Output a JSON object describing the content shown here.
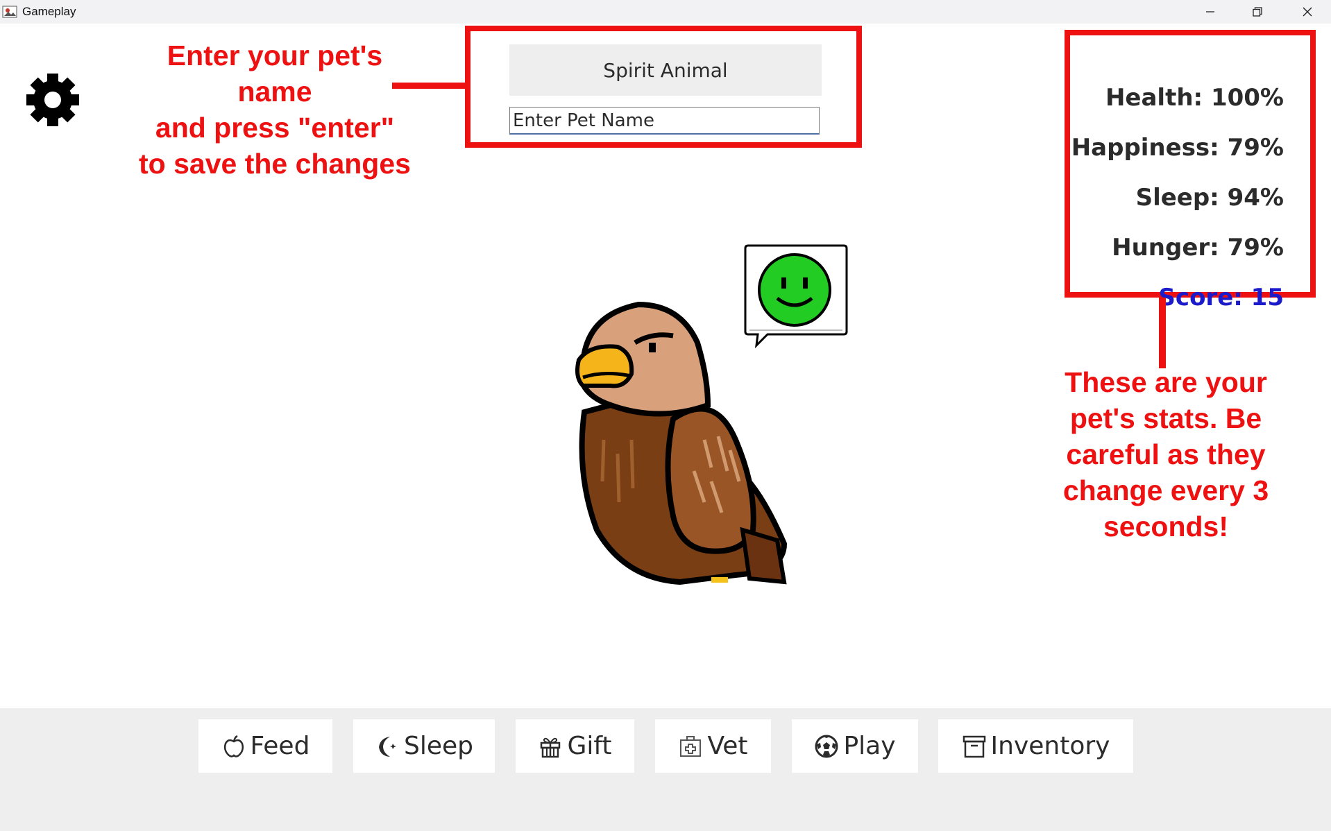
{
  "window": {
    "title": "Gameplay",
    "controls": [
      "minimize",
      "restore",
      "close"
    ]
  },
  "pet": {
    "name_display": "Spirit Animal",
    "name_input_placeholder": "Enter Pet Name",
    "mood_icon": "happy-face-icon",
    "mood_color": "#22cc22"
  },
  "stats": {
    "health": "Health: 100%",
    "happiness": "Happiness: 79%",
    "sleep": "Sleep: 94%",
    "hunger": "Hunger: 79%",
    "score": "Score: 15"
  },
  "annotations": {
    "name_help": "Enter your pet's name\nand press \"enter\"\nto save the changes",
    "stats_help": "These are your\npet's stats. Be\ncareful as they\nchange every 3\nseconds!"
  },
  "actions": [
    {
      "label": "Feed",
      "icon": "apple-icon"
    },
    {
      "label": "Sleep",
      "icon": "moon-icon"
    },
    {
      "label": "Gift",
      "icon": "gift-icon"
    },
    {
      "label": "Vet",
      "icon": "medical-kit-icon"
    },
    {
      "label": "Play",
      "icon": "soccer-ball-icon"
    },
    {
      "label": "Inventory",
      "icon": "archive-box-icon"
    }
  ],
  "colors": {
    "annotation_red": "#ee1111",
    "score_blue": "#1b1bcc",
    "stat_text": "#2b2b2b",
    "bottom_bar": "#eeeeee"
  }
}
